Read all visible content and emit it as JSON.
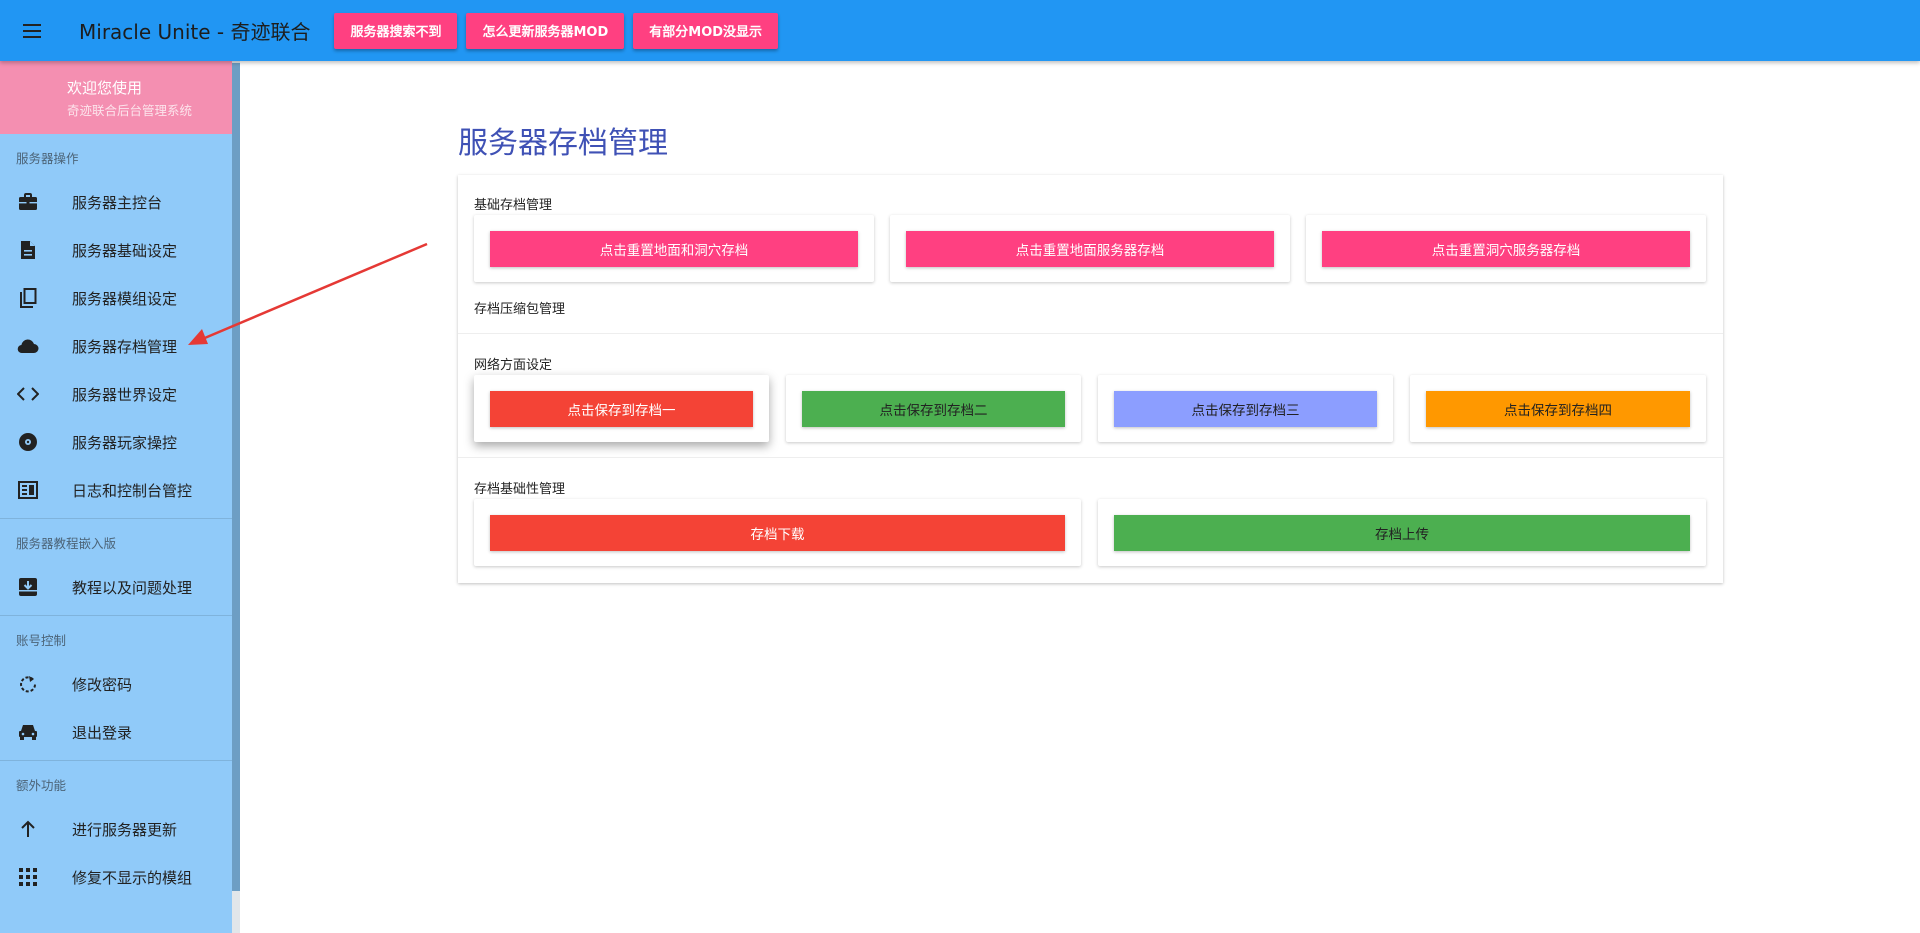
{
  "header": {
    "title": "Miracle Unite - 奇迹联合",
    "buttons": [
      "服务器搜索不到",
      "怎么更新服务器MOD",
      "有部分MOD没显示"
    ]
  },
  "sidebar": {
    "welcome_title": "欢迎您使用",
    "welcome_subtitle": "奇迹联合后台管理系统",
    "sections": [
      {
        "label": "服务器操作",
        "items": [
          "服务器主控台",
          "服务器基础设定",
          "服务器模组设定",
          "服务器存档管理",
          "服务器世界设定",
          "服务器玩家操控",
          "日志和控制台管控"
        ]
      },
      {
        "label": "服务器教程嵌入版",
        "items": [
          "教程以及问题处理"
        ]
      },
      {
        "label": "账号控制",
        "items": [
          "修改密码",
          "退出登录"
        ]
      },
      {
        "label": "额外功能",
        "items": [
          "进行服务器更新",
          "修复不显示的模组"
        ]
      }
    ]
  },
  "main": {
    "page_title": "服务器存档管理",
    "basic_archive": {
      "title": "基础存档管理",
      "buttons": [
        "点击重置地面和洞穴存档",
        "点击重置地面服务器存档",
        "点击重置洞穴服务器存档"
      ]
    },
    "compress_title": "存档压缩包管理",
    "network": {
      "title": "网络方面设定",
      "buttons": [
        "点击保存到存档一",
        "点击保存到存档二",
        "点击保存到存档三",
        "点击保存到存档四"
      ]
    },
    "archive_basic": {
      "title": "存档基础性管理",
      "buttons": [
        "存档下载",
        "存档上传"
      ]
    }
  },
  "colors": {
    "topbar": "#2196f3",
    "sidebar": "#90caf9",
    "welcome": "#f48fb1",
    "accent_pink": "#ff4081",
    "red": "#f44336",
    "green": "#4caf50",
    "lavender": "#8c9eff",
    "orange": "#ff9800",
    "title_blue": "#3f51b5",
    "arrow": "#e53935"
  },
  "icons": [
    "menu-icon",
    "briefcase-icon",
    "document-icon",
    "copy-icon",
    "cloud-icon",
    "code-icon",
    "disc-icon",
    "console-icon",
    "download-box-icon",
    "rotate-icon",
    "car-icon",
    "arrow-up-icon",
    "apps-grid-icon"
  ]
}
